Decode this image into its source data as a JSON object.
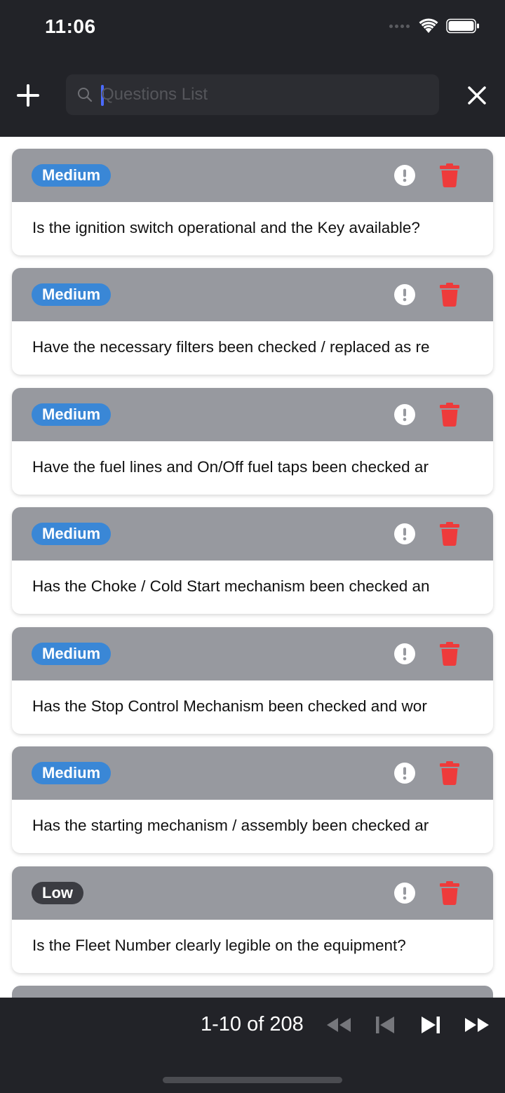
{
  "status_bar": {
    "time": "11:06"
  },
  "search": {
    "placeholder": "Questions List",
    "value": ""
  },
  "questions": [
    {
      "priority": "Medium",
      "text": "Is the ignition switch operational and the Key available?"
    },
    {
      "priority": "Medium",
      "text": "Have the necessary filters been checked / replaced as re"
    },
    {
      "priority": "Medium",
      "text": "Have the fuel lines and On/Off fuel taps been checked ar"
    },
    {
      "priority": "Medium",
      "text": "Has the Choke / Cold Start mechanism been checked an"
    },
    {
      "priority": "Medium",
      "text": "Has the Stop Control Mechanism been checked and wor"
    },
    {
      "priority": "Medium",
      "text": "Has the starting mechanism / assembly been checked ar"
    },
    {
      "priority": "Low",
      "text": "Is the Fleet Number clearly legible on the equipment?"
    }
  ],
  "pagination": {
    "range_label": "1-10 of 208"
  },
  "colors": {
    "header_bg": "#222328",
    "card_header_bg": "#97999f",
    "badge_medium": "#3a87d6",
    "badge_low": "#3b3c42",
    "delete_red": "#ee3b3b",
    "caret_blue": "#4b6bff"
  },
  "icons": {
    "add": "plus-icon",
    "search": "search-icon",
    "close": "close-icon",
    "info": "exclamation-circle-icon",
    "delete": "trash-icon",
    "first": "rewind-icon",
    "prev": "skip-back-icon",
    "next": "skip-forward-icon",
    "last": "fast-forward-icon"
  }
}
